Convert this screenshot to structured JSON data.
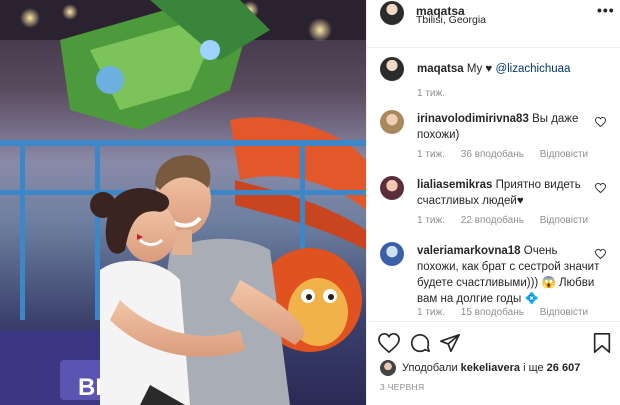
{
  "post": {
    "author": "maqatsa",
    "location": "Tbilisi, Georgia",
    "caption_text": "My",
    "caption_heart": "♥",
    "caption_mention": "@lizachichuaa",
    "caption_time": "1 тиж.",
    "sign_text": "BLAC"
  },
  "comments": [
    {
      "user": "irinavolodimirivna83",
      "text": "Вы даже похожи)",
      "time": "1 тиж.",
      "likes": "36 вподобань",
      "reply": "Відповісти"
    },
    {
      "user": "lialiasemikras",
      "text": "Приятно видеть счастливых людей♥",
      "time": "1 тиж.",
      "likes": "22 вподобань",
      "reply": "Відповісти"
    },
    {
      "user": "valeriamarkovna18",
      "text": "Очень похожи, как брат с сестрой значит будете счастливыми))) 😱 Любви вам на долгие годы 💠",
      "time": "1 тиж.",
      "likes": "15 вподобань",
      "reply": "Відповісти"
    }
  ],
  "actions": {
    "liked_by_prefix": "Уподобали",
    "liked_by_user": "kekeliavera",
    "liked_by_connector": "і ще",
    "liked_by_count": "26 607",
    "date": "3 ЧЕРВНЯ"
  },
  "icons": {
    "more": "more-options-icon",
    "like": "heart-icon",
    "comment": "comment-icon",
    "share": "share-icon",
    "save": "bookmark-icon"
  },
  "colors": {
    "text": "#262626",
    "secondary": "#8e8e8e",
    "mention": "#00376b",
    "divider": "#efefef"
  }
}
